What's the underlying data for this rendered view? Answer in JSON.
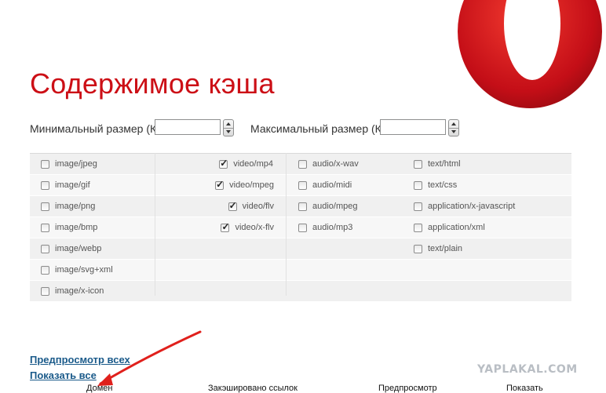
{
  "page": {
    "title": "Содержимое кэша"
  },
  "size_filters": {
    "min_label": "Минимальный размер (Кб)",
    "min_value": "",
    "max_label": "Максимальный размер (Кб)",
    "max_value": ""
  },
  "types": {
    "image": [
      {
        "label": "image/jpeg",
        "checked": false
      },
      {
        "label": "image/gif",
        "checked": false
      },
      {
        "label": "image/png",
        "checked": false
      },
      {
        "label": "image/bmp",
        "checked": false
      },
      {
        "label": "image/webp",
        "checked": false
      },
      {
        "label": "image/svg+xml",
        "checked": false
      },
      {
        "label": "image/x-icon",
        "checked": false
      }
    ],
    "video": [
      {
        "label": "video/mp4",
        "checked": true
      },
      {
        "label": "video/mpeg",
        "checked": true
      },
      {
        "label": "video/flv",
        "checked": true
      },
      {
        "label": "video/x-flv",
        "checked": true
      }
    ],
    "audio": [
      {
        "label": "audio/x-wav",
        "checked": false
      },
      {
        "label": "audio/midi",
        "checked": false
      },
      {
        "label": "audio/mpeg",
        "checked": false
      },
      {
        "label": "audio/mp3",
        "checked": false
      }
    ],
    "text": [
      {
        "label": "text/html",
        "checked": false
      },
      {
        "label": "text/css",
        "checked": false
      },
      {
        "label": "application/x-javascript",
        "checked": false
      },
      {
        "label": "application/xml",
        "checked": false
      },
      {
        "label": "text/plain",
        "checked": false
      }
    ]
  },
  "links": {
    "preview_all": "Предпросмотр всех",
    "show_all": "Показать все"
  },
  "table_headers": [
    "Домен",
    "Закэшировано ссылок",
    "Предпросмотр",
    "Показать"
  ],
  "watermark": "YAPLAKAL.COM",
  "colors": {
    "title": "#cc0f16",
    "link": "#1a5a8a",
    "logo": "#d0121b",
    "arrow": "#e0201c"
  }
}
